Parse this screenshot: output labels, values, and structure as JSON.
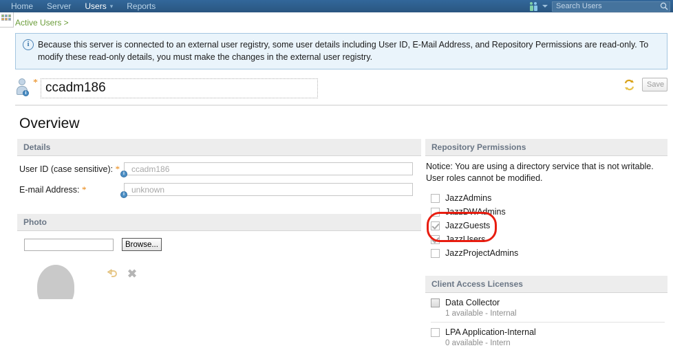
{
  "topnav": {
    "items": [
      {
        "label": "Home",
        "active": false
      },
      {
        "label": "Server",
        "active": false
      },
      {
        "label": "Users",
        "active": true
      },
      {
        "label": "Reports",
        "active": false
      }
    ],
    "search": {
      "placeholder": "Search Users",
      "value": ""
    }
  },
  "breadcrumb": {
    "text": "Active Users >"
  },
  "banner": {
    "icon": "info-icon",
    "text": "Because this server is connected to an external user registry, some user details including User ID, E-Mail Address, and Repository Permissions are read-only. To modify these read-only details, you must make the changes in the external user registry."
  },
  "title_row": {
    "required_marker": "*",
    "user_name": "ccadm186",
    "sync_tooltip": "refresh",
    "save_label": "Save"
  },
  "overview": {
    "heading": "Overview"
  },
  "details": {
    "header": "Details",
    "fields": [
      {
        "label": "User ID (case sensitive):",
        "required": "*",
        "value": "",
        "placeholder": "ccadm186"
      },
      {
        "label": "E-mail Address:",
        "required": "*",
        "value": "",
        "placeholder": "unknown"
      }
    ]
  },
  "photo": {
    "header": "Photo",
    "file_value": "",
    "file_placeholder": "",
    "browse_label": "Browse..."
  },
  "repository_permissions": {
    "header": "Repository Permissions",
    "notice": "Notice: You are using a directory service that is not writable. User roles cannot be modified.",
    "items": [
      {
        "label": "JazzAdmins",
        "checked": false
      },
      {
        "label": "JazzDWAdmins",
        "checked": false
      },
      {
        "label": "JazzGuests",
        "checked": true
      },
      {
        "label": "JazzUsers",
        "checked": true
      },
      {
        "label": "JazzProjectAdmins",
        "checked": false
      }
    ],
    "annotation_color": "#e81d10"
  },
  "client_access_licenses": {
    "header": "Client Access Licenses",
    "items": [
      {
        "name": "Data Collector",
        "availability": "1 available - Internal",
        "checked": false,
        "shaded": true
      },
      {
        "name": "LPA Application-Internal",
        "availability": "0 available - Intern",
        "checked": false,
        "shaded": false
      }
    ]
  },
  "colors": {
    "header_blue": "#2b5d8a",
    "breadcrumb_green": "#6b9d3a",
    "banner_bg": "#eaf4fb",
    "required_orange": "#e8830c",
    "annotation_red": "#e81d10"
  }
}
